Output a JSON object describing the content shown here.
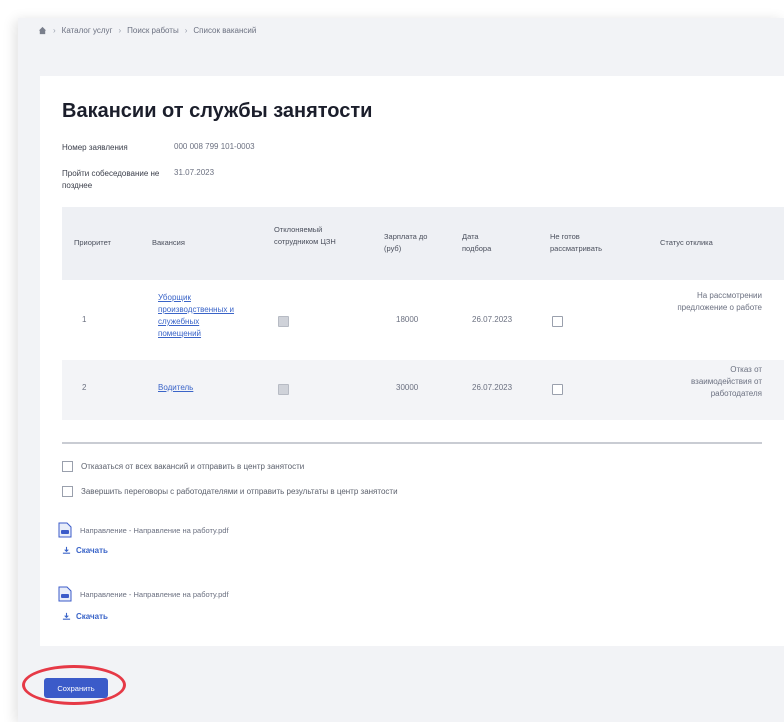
{
  "breadcrumb": [
    "Каталог услуг",
    "Поиск работы",
    "Список вакансий"
  ],
  "title": "Вакансии от службы занятости",
  "meta": {
    "app_number_label": "Номер заявления",
    "app_number_value": "000 008 799 101-0003",
    "interview_label": "Пройти собеседование не позднее",
    "interview_value": "31.07.2023"
  },
  "table": {
    "headers": [
      "Приоритет",
      "Вакансия",
      "Отклоняемый сотрудником ЦЗН",
      "Зарплата до (руб)",
      "Дата подбора",
      "Не готов рассматривать",
      "Статус отклика"
    ],
    "rows": [
      {
        "priority": "1",
        "vacancy": "Уборщик производственных и служебных помещений",
        "salary": "18000",
        "date": "26.07.2023",
        "status": "На рассмотрении предложение о работе"
      },
      {
        "priority": "2",
        "vacancy": "Водитель",
        "salary": "30000",
        "date": "26.07.2023",
        "status": "Отказ от взаимодействия от работодателя"
      }
    ]
  },
  "options": {
    "reject_all": "Отказаться от всех вакансий и отправить в центр занятости",
    "finish": "Завершить переговоры с работодателями и отправить результаты в центр занятости"
  },
  "documents": [
    {
      "label": "Направление - Направление на работу.pdf",
      "download": "Скачать"
    },
    {
      "label": "Направление - Направление на работу.pdf",
      "download": "Скачать"
    }
  ],
  "save_button": "Сохранить",
  "colors": {
    "accent": "#3b5bc9",
    "highlight": "#e63946",
    "link": "#3a64c8"
  }
}
